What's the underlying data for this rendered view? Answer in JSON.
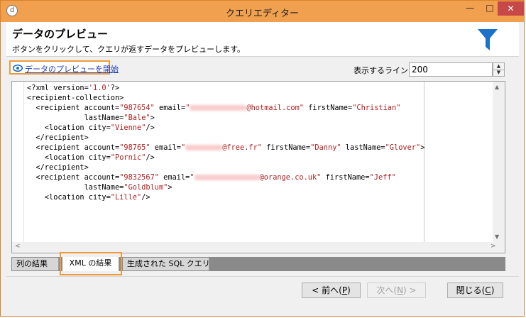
{
  "window": {
    "title": "クエリエディター",
    "app_icon_glyph": "d",
    "minimize_glyph": "—",
    "maximize_glyph": "□",
    "close_glyph": "✕"
  },
  "header": {
    "title": "データのプレビュー",
    "subtitle": "ボタンをクリックして、クエリが返すデータをプレビューします。",
    "icon": "funnel-icon",
    "icon_color": "#1a73c8"
  },
  "toolbar": {
    "start_preview_link": "データのプレビューを開始",
    "lines_label": "表示するライン:",
    "lines_value": "200"
  },
  "xml_lines": [
    "<?xml version='1.0'?>",
    "<recipient-collection>",
    "  <recipient account=\"987654\" email=\"@hotmail.com\" firstName=\"Christian\"",
    "             lastName=\"Bale\">",
    "    <location city=\"Vienne\"/>",
    "  </recipient>",
    "  <recipient account=\"98765\" email=\"@free.fr\" firstName=\"Danny\" lastName=\"Glover\">",
    "    <location city=\"Pornic\"/>",
    "  </recipient>",
    "  <recipient account=\"9832567\" email=\"@orange.co.uk\" firstName=\"Jeff\"",
    "             lastName=\"Goldblum\">",
    "    <location city=\"Lille\"/>"
  ],
  "xml": {
    "l0_a": "<?xml version=",
    "l0_b": "'1.0'",
    "l0_c": "?>",
    "l1": "<recipient-collection>",
    "r1_account": "\"987654\"",
    "r1_email": "@hotmail.com\"",
    "r1_first": "\"Christian\"",
    "r1_last": "\"Bale\"",
    "r1_city": "\"Vienne\"",
    "r2_account": "\"98765\"",
    "r2_email": "@free.fr\"",
    "r2_first": "\"Danny\"",
    "r2_last": "\"Glover\"",
    "r2_city": "\"Pornic\"",
    "r3_account": "\"9832567\"",
    "r3_email": "@orange.co.uk\"",
    "r3_first": "\"Jeff\"",
    "r3_last": "\"Goldblum\"",
    "r3_city": "\"Lille\""
  },
  "tabs": [
    {
      "label": "列の結果"
    },
    {
      "label": "XML の結果"
    },
    {
      "label": "生成された SQL クエリ"
    }
  ],
  "buttons": {
    "prev_label": "< 前へ(",
    "prev_key": "P",
    "prev_end": ")",
    "next_label": "次へ(",
    "next_key": "N",
    "next_end": ") >",
    "close_label": "閉じる(",
    "close_key": "C",
    "close_end": ")"
  }
}
